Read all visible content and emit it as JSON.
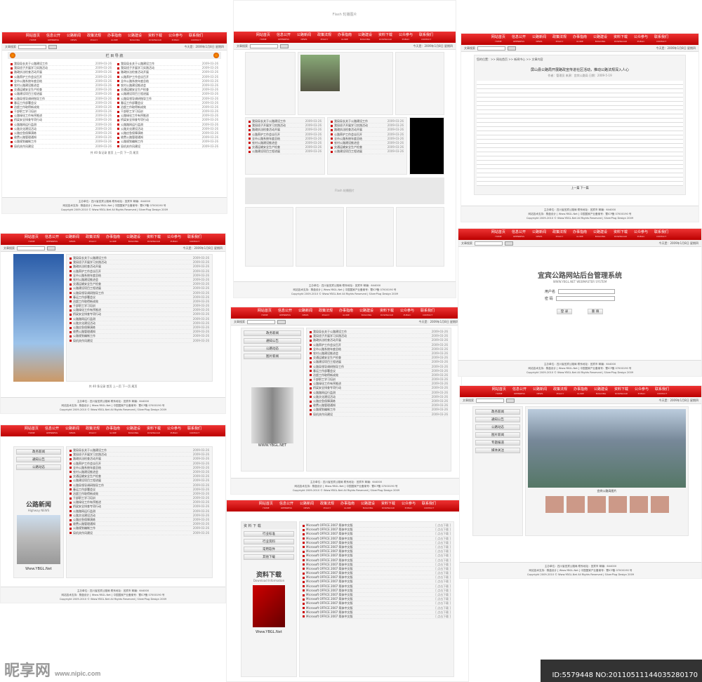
{
  "nav_items": [
    {
      "cn": "网站首页",
      "en": "HOME"
    },
    {
      "cn": "信息公开",
      "en": "OPENNESS"
    },
    {
      "cn": "公路新闻",
      "en": "NEWS"
    },
    {
      "cn": "政策法规",
      "en": "POLICY"
    },
    {
      "cn": "办事指南",
      "en": "GUIDE"
    },
    {
      "cn": "公路建设",
      "en": "BUILDING"
    },
    {
      "cn": "资料下载",
      "en": "DOWNLOAD"
    },
    {
      "cn": "公众参与",
      "en": "PUBLIC"
    },
    {
      "cn": "联系我们",
      "en": "CONTACT"
    }
  ],
  "search": {
    "label": "文章搜索",
    "button": "搜索"
  },
  "date_text": "今天是：2009年1月8日 星期四",
  "list_head": "栏 目 导 航",
  "dl_head": "资 料 下 载",
  "news_rows": [
    {
      "t": "我局局长关于公路建设工作",
      "d": "2009-03-26"
    },
    {
      "t": "我局班子开展学习实践活动",
      "d": "2009-03-26"
    },
    {
      "t": "路政执法检查活动开展",
      "d": "2009-03-26"
    },
    {
      "t": "公路养护工作会议召开",
      "d": "2009-03-26"
    },
    {
      "t": "全市公路系统年度总结",
      "d": "2009-03-26"
    },
    {
      "t": "农村公路建设推进会",
      "d": "2009-03-26"
    },
    {
      "t": "交通运输安全生产检查",
      "d": "2009-03-26"
    },
    {
      "t": "公路建设项目工程进展",
      "d": "2009-03-26"
    },
    {
      "t": "公路局领导调研指导工作",
      "d": "2009-03-26"
    },
    {
      "t": "春运工作部署会议",
      "d": "2009-03-26"
    },
    {
      "t": "治超工作取得新成效",
      "d": "2009-03-26"
    },
    {
      "t": "干部职工学习培训",
      "d": "2009-03-26"
    },
    {
      "t": "公路绿化工作有序推进",
      "d": "2009-03-26"
    },
    {
      "t": "桥梁安全排查专项行动",
      "d": "2009-03-26"
    },
    {
      "t": "公路路网运行监测",
      "d": "2009-03-26"
    },
    {
      "t": "公路文化建设活动",
      "d": "2009-03-26"
    },
    {
      "t": "公路应急保障演练",
      "d": "2009-03-26"
    },
    {
      "t": "收费公路管理通知",
      "d": "2009-03-26"
    },
    {
      "t": "公路规划编制工作",
      "d": "2009-03-26"
    },
    {
      "t": "局机关作风建设",
      "d": "2009-03-26"
    }
  ],
  "dl_rows": [
    {
      "t": "Microsoft OFFICE 2007 简体中文版",
      "d": "[ 点击下载 ]"
    },
    {
      "t": "Microsoft OFFICE 2007 简体中文版",
      "d": "[ 点击下载 ]"
    },
    {
      "t": "Microsoft OFFICE 2007 简体中文版",
      "d": "[ 点击下载 ]"
    },
    {
      "t": "Microsoft OFFICE 2007 简体中文版",
      "d": "[ 点击下载 ]"
    },
    {
      "t": "Microsoft OFFICE 2007 简体中文版",
      "d": "[ 点击下载 ]"
    },
    {
      "t": "Microsoft OFFICE 2007 简体中文版",
      "d": "[ 点击下载 ]"
    },
    {
      "t": "Microsoft OFFICE 2007 简体中文版",
      "d": "[ 点击下载 ]"
    },
    {
      "t": "Microsoft OFFICE 2007 简体中文版",
      "d": "[ 点击下载 ]"
    },
    {
      "t": "Microsoft OFFICE 2007 简体中文版",
      "d": "[ 点击下载 ]"
    },
    {
      "t": "Microsoft OFFICE 2007 简体中文版",
      "d": "[ 点击下载 ]"
    },
    {
      "t": "Microsoft OFFICE 2007 简体中文版",
      "d": "[ 点击下载 ]"
    },
    {
      "t": "Microsoft OFFICE 2007 简体中文版",
      "d": "[ 点击下载 ]"
    },
    {
      "t": "Microsoft OFFICE 2007 简体中文版",
      "d": "[ 点击下载 ]"
    },
    {
      "t": "Microsoft OFFICE 2007 简体中文版",
      "d": "[ 点击下载 ]"
    },
    {
      "t": "Microsoft OFFICE 2007 简体中文版",
      "d": "[ 点击下载 ]"
    },
    {
      "t": "Microsoft OFFICE 2007 简体中文版",
      "d": "[ 点击下载 ]"
    },
    {
      "t": "Microsoft OFFICE 2007 简体中文版",
      "d": "[ 点击下载 ]"
    },
    {
      "t": "Microsoft OFFICE 2007 简体中文版",
      "d": "[ 点击下载 ]"
    },
    {
      "t": "Microsoft OFFICE 2007 简体中文版",
      "d": "[ 点击下载 ]"
    },
    {
      "t": "Microsoft OFFICE 2007 简体中文版",
      "d": "[ 点击下载 ]"
    },
    {
      "t": "Microsoft OFFICE 2007 简体中文版",
      "d": "[ 点击下载 ]"
    },
    {
      "t": "Microsoft OFFICE 2007 简体中文版",
      "d": "[ 点击下载 ]"
    }
  ],
  "side_menu": [
    "政务新闻",
    "通知公告",
    "公路动态",
    "图片新闻",
    "专题报道",
    "媒体关注"
  ],
  "dl_menu": [
    "行业标准",
    "行业资料",
    "常用软件",
    "其他下载"
  ],
  "pager": "共 40 条记录  首页  上一页  下一页  尾页",
  "footer": {
    "l1": "主办单位：四川省宜宾公路局  联系地址：宜宾市   邮编：644000",
    "l2": "网站技术支持：棋盘设计 [ Www.YBGL.Net ]   中国国家产业备案号：蜀ICP备 07000190 号",
    "l3": "Copyright 2009-2010 © Www.YBGL.Net All Rights Reserved | SilverPlug Design 2009"
  },
  "flash_text": "Flash 轮播图片",
  "login": {
    "title": "宜宾公路网站后台管理系统",
    "sub": "WWW.YBGL.NET WEBMASTER SYSTEM",
    "user": "用户名",
    "pass": "密  码",
    "login_btn": "登 录",
    "reset_btn": "重 填"
  },
  "article": {
    "crumb": "您的位置：>> 网站首页 >> 新闻中心 >> 文章内容",
    "title": "屏山县公路局开展路政宣传进社区活动，推动公路法规深入人心",
    "meta": "作者：管理员   来源：宜宾公路局   日期：2009-5-19",
    "pager": "上一篇    下一篇"
  },
  "sidebar_news": {
    "title": "公路新闻",
    "en": "Highway NEWS",
    "url": "Www.YBGL.Net"
  },
  "download_banner": {
    "title": "资料下载",
    "en": "Download Information",
    "url": "Www.YBGL.Net"
  },
  "pillar_url": "WWW.YBGL.NET",
  "photo_caption": "宜宾公路局图片",
  "watermark": "昵享网",
  "watermark_url": "www.nipic.com",
  "id_text": "ID:5579448 NO:20110511144035280170"
}
